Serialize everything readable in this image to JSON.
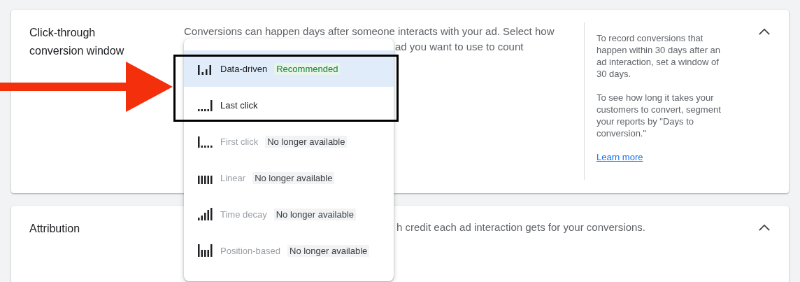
{
  "sections": [
    {
      "title": "Click-through conversion window",
      "description_lines": [
        "Conversions can happen days after someone interacts with your ad. Select how",
        "ad you want to use to count"
      ],
      "help": [
        "To record conversions that happen within 30 days after an ad interaction, set a window of 30 days.",
        "To see how long it takes your customers to convert, segment your reports by \"Days to conversion.\""
      ],
      "help_link": "Learn more",
      "expanded": true
    },
    {
      "title": "Attribution",
      "description_lines": [
        "h credit each ad interaction gets for your conversions."
      ],
      "expanded": true
    }
  ],
  "menu": {
    "items": [
      {
        "kind": "data-driven",
        "label": "Data-driven",
        "badge": "Recommended",
        "disabled": false,
        "selected": true
      },
      {
        "kind": "last-click",
        "label": "Last click",
        "disabled": false,
        "selected": false
      },
      {
        "kind": "first-click",
        "label": "First click",
        "badge": "No longer available",
        "disabled": true,
        "selected": false
      },
      {
        "kind": "linear",
        "label": "Linear",
        "badge": "No longer available",
        "disabled": true,
        "selected": false
      },
      {
        "kind": "time-decay",
        "label": "Time decay",
        "badge": "No longer available",
        "disabled": true,
        "selected": false
      },
      {
        "kind": "position-based",
        "label": "Position-based",
        "badge": "No longer available",
        "disabled": true,
        "selected": false
      }
    ]
  },
  "annotation": {
    "arrow": true,
    "highlight_box": true
  }
}
